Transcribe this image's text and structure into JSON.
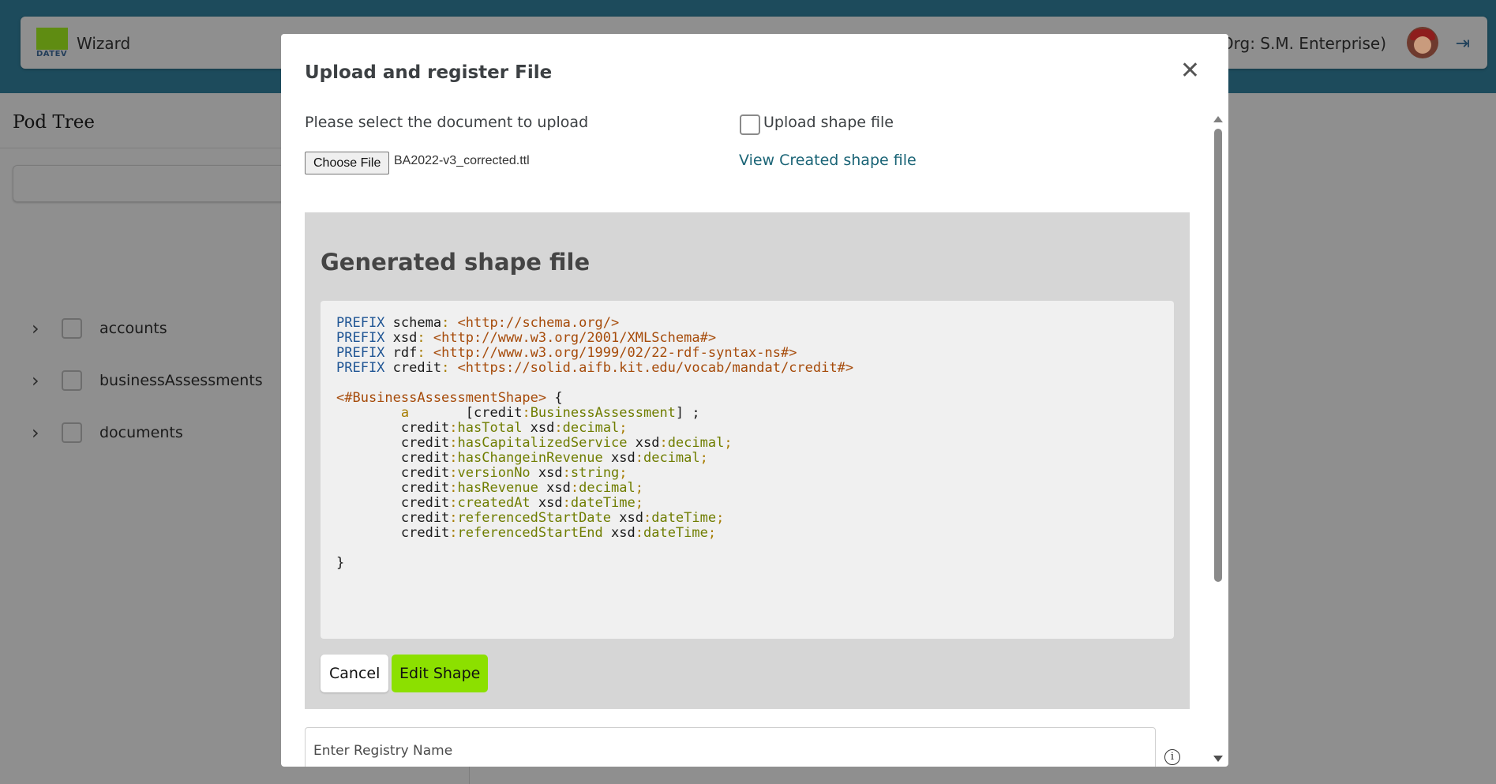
{
  "app": {
    "title": "Wizard",
    "logo_text": "DATEV",
    "org_label": "r (Org: S.M. Enterprise)"
  },
  "sidebar": {
    "title": "Pod Tree",
    "items": [
      {
        "label": "accounts"
      },
      {
        "label": "businessAssessments"
      },
      {
        "label": "documents"
      }
    ]
  },
  "modal": {
    "title": "Upload and register File",
    "select_label": "Please select the document to upload",
    "choose_file_label": "Choose File",
    "file_name": "BA2022-v3_corrected.ttl",
    "upload_shape_label": "Upload shape file",
    "upload_shape_checked": false,
    "view_shape_link": "View Created shape file",
    "generated_title": "Generated shape file",
    "code": {
      "prefixes": [
        {
          "kw": "PREFIX",
          "name": "schema",
          "uri": "<http://schema.org/>"
        },
        {
          "kw": "PREFIX",
          "name": "xsd",
          "uri": "<http://www.w3.org/2001/XMLSchema#>"
        },
        {
          "kw": "PREFIX",
          "name": "rdf",
          "uri": "<http://www.w3.org/1999/02/22-rdf-syntax-ns#>"
        },
        {
          "kw": "PREFIX",
          "name": "credit",
          "uri": "<https://solid.aifb.kit.edu/vocab/mandat/credit#>"
        }
      ],
      "shape_name": "<#BusinessAssessmentShape>",
      "type_line": {
        "a": "a",
        "cls_prefix": "credit",
        "cls_name": "BusinessAssessment"
      },
      "properties": [
        {
          "prop": "hasTotal",
          "type": "decimal"
        },
        {
          "prop": "hasCapitalizedService",
          "type": "decimal"
        },
        {
          "prop": "hasChangeinRevenue",
          "type": "decimal"
        },
        {
          "prop": "versionNo",
          "type": "string"
        },
        {
          "prop": "hasRevenue",
          "type": "decimal"
        },
        {
          "prop": "createdAt",
          "type": "dateTime"
        },
        {
          "prop": "referencedStartDate",
          "type": "dateTime"
        },
        {
          "prop": "referencedStartEnd",
          "type": "dateTime"
        }
      ]
    },
    "cancel_label": "Cancel",
    "edit_shape_label": "Edit Shape",
    "registry_placeholder": "Enter Registry Name"
  },
  "colors": {
    "accent_green": "#8ce000",
    "link": "#1a6476",
    "header_bg": "#1d4b5c"
  }
}
